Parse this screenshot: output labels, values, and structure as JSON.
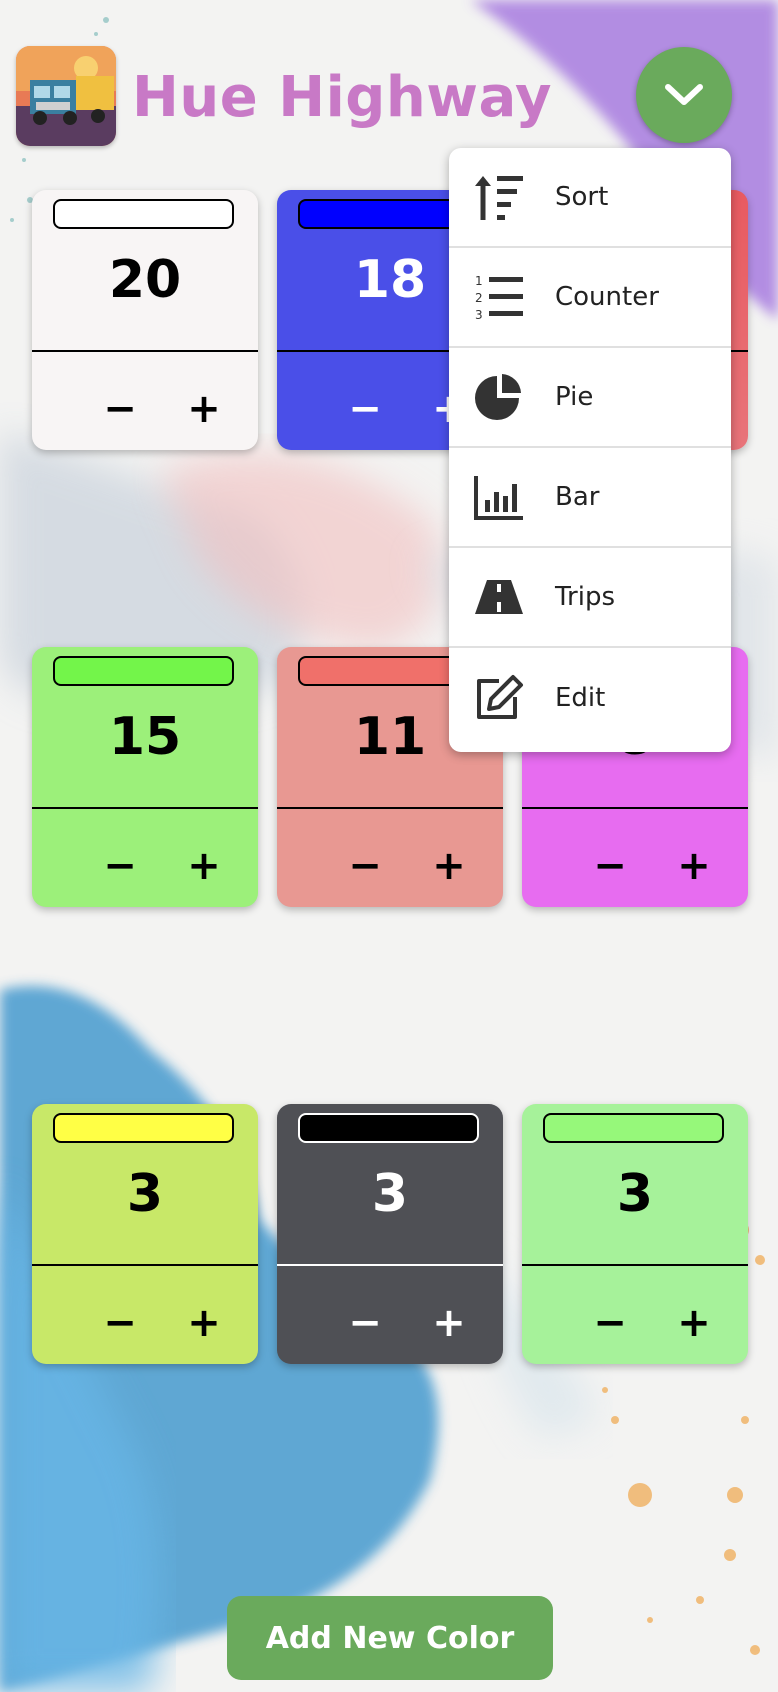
{
  "app": {
    "title": "Hue Highway"
  },
  "menu": {
    "items": [
      {
        "label": "Sort",
        "icon": "sort-icon"
      },
      {
        "label": "Counter",
        "icon": "numbered-list-icon"
      },
      {
        "label": "Pie",
        "icon": "pie-chart-icon"
      },
      {
        "label": "Bar",
        "icon": "bar-chart-icon"
      },
      {
        "label": "Trips",
        "icon": "road-icon"
      },
      {
        "label": "Edit",
        "icon": "edit-icon"
      }
    ]
  },
  "cards": [
    {
      "count": "20",
      "minus": "−",
      "plus": "+",
      "swatch": "#ffffff",
      "bg": "#f8f5f5",
      "text": "#000000",
      "line": "#000000"
    },
    {
      "count": "18",
      "minus": "−",
      "plus": "+",
      "swatch": "#0000ff",
      "bg": "#4a4fe8",
      "text": "#ffffff",
      "line": "#000000"
    },
    {
      "count": "",
      "minus": "",
      "plus": "",
      "swatch": "#e8303a",
      "bg": "#e8747a",
      "text": "#000000",
      "line": "#000000"
    },
    {
      "count": "15",
      "minus": "−",
      "plus": "+",
      "swatch": "#73f54a",
      "bg": "#9cf07a",
      "text": "#000000",
      "line": "#000000"
    },
    {
      "count": "11",
      "minus": "−",
      "plus": "+",
      "swatch": "#f0706a",
      "bg": "#e89892",
      "text": "#000000",
      "line": "#000000"
    },
    {
      "count": "8",
      "minus": "−",
      "plus": "+",
      "swatch": "#e060f0",
      "bg": "#e76cf0",
      "text": "#000000",
      "line": "#000000"
    },
    {
      "count": "3",
      "minus": "−",
      "plus": "+",
      "swatch": "#ffff45",
      "bg": "#c8e868",
      "text": "#000000",
      "line": "#000000"
    },
    {
      "count": "3",
      "minus": "−",
      "plus": "+",
      "swatch": "#000000",
      "bg": "#4f5055",
      "text": "#ffffff",
      "line": "#ffffff"
    },
    {
      "count": "3",
      "minus": "−",
      "plus": "+",
      "swatch": "#96f87a",
      "bg": "#a6f29a",
      "text": "#000000",
      "line": "#000000"
    }
  ],
  "actions": {
    "add_label": "Add New Color"
  },
  "colors": {
    "accent": "#6aaa5c",
    "title": "#c879c6"
  }
}
